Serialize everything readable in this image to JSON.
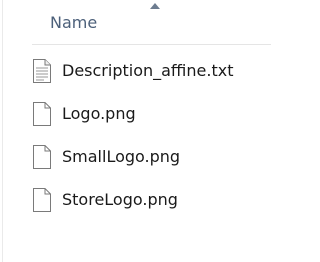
{
  "header": {
    "column_label": "Name",
    "sort_direction": "ascending"
  },
  "files": [
    {
      "name": "Description_affine.txt",
      "icon": "text-file-icon"
    },
    {
      "name": "Logo.png",
      "icon": "file-icon"
    },
    {
      "name": "SmallLogo.png",
      "icon": "file-icon"
    },
    {
      "name": "StoreLogo.png",
      "icon": "file-icon"
    }
  ],
  "colors": {
    "header_text": "#4c607a",
    "file_text": "#1a1a1a",
    "icon_stroke": "#7a7a7a"
  }
}
